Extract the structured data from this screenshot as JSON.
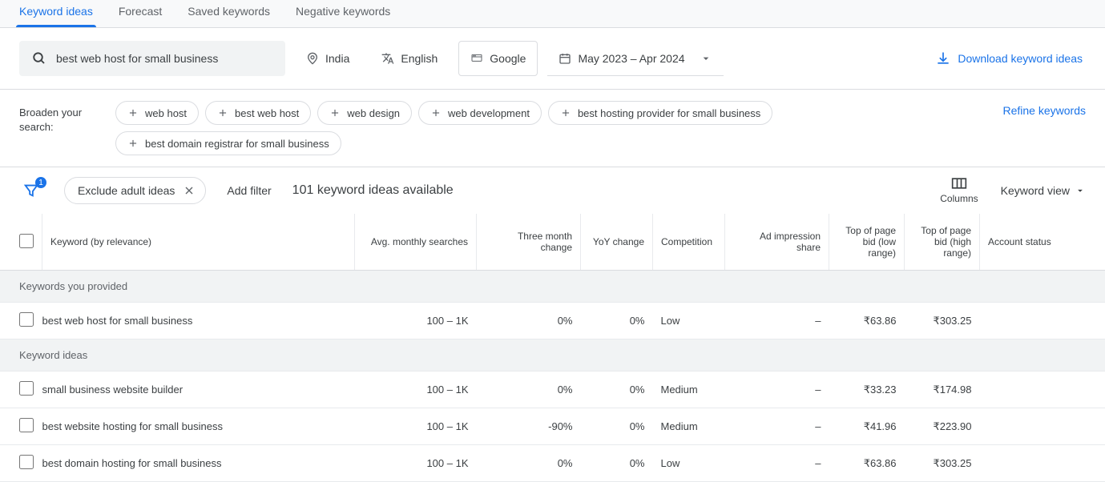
{
  "tabs": {
    "keyword_ideas": "Keyword ideas",
    "forecast": "Forecast",
    "saved_keywords": "Saved keywords",
    "negative_keywords": "Negative keywords"
  },
  "search": {
    "query": "best web host for small business"
  },
  "settings": {
    "location": "India",
    "language": "English",
    "network": "Google",
    "daterange": "May 2023 – Apr 2024"
  },
  "download_label": "Download keyword ideas",
  "broaden": {
    "label": "Broaden your search:",
    "chips": [
      "web host",
      "best web host",
      "web design",
      "web development",
      "best hosting provider for small business",
      "best domain registrar for small business"
    ],
    "refine": "Refine keywords"
  },
  "filter_bar": {
    "badge": "1",
    "exclude_adult": "Exclude adult ideas",
    "add_filter": "Add filter",
    "ideas_count": "101 keyword ideas available",
    "columns": "Columns",
    "keyword_view": "Keyword view"
  },
  "headers": {
    "keyword": "Keyword (by relevance)",
    "searches": "Avg. monthly searches",
    "three_month": "Three month change",
    "yoy": "YoY change",
    "competition": "Competition",
    "ad_share": "Ad impression share",
    "bid_low": "Top of page bid (low range)",
    "bid_high": "Top of page bid (high range)",
    "account_status": "Account status"
  },
  "sections": {
    "provided": "Keywords you provided",
    "ideas": "Keyword ideas"
  },
  "rows": {
    "provided0": {
      "keyword": "best web host for small business",
      "searches": "100 – 1K",
      "three_month": "0%",
      "yoy": "0%",
      "competition": "Low",
      "ad_share": "–",
      "bid_low": "₹63.86",
      "bid_high": "₹303.25",
      "account_status": ""
    },
    "idea0": {
      "keyword": "small business website builder",
      "searches": "100 – 1K",
      "three_month": "0%",
      "yoy": "0%",
      "competition": "Medium",
      "ad_share": "–",
      "bid_low": "₹33.23",
      "bid_high": "₹174.98",
      "account_status": ""
    },
    "idea1": {
      "keyword": "best website hosting for small business",
      "searches": "100 – 1K",
      "three_month": "-90%",
      "yoy": "0%",
      "competition": "Medium",
      "ad_share": "–",
      "bid_low": "₹41.96",
      "bid_high": "₹223.90",
      "account_status": ""
    },
    "idea2": {
      "keyword": "best domain hosting for small business",
      "searches": "100 – 1K",
      "three_month": "0%",
      "yoy": "0%",
      "competition": "Low",
      "ad_share": "–",
      "bid_low": "₹63.86",
      "bid_high": "₹303.25",
      "account_status": ""
    }
  }
}
